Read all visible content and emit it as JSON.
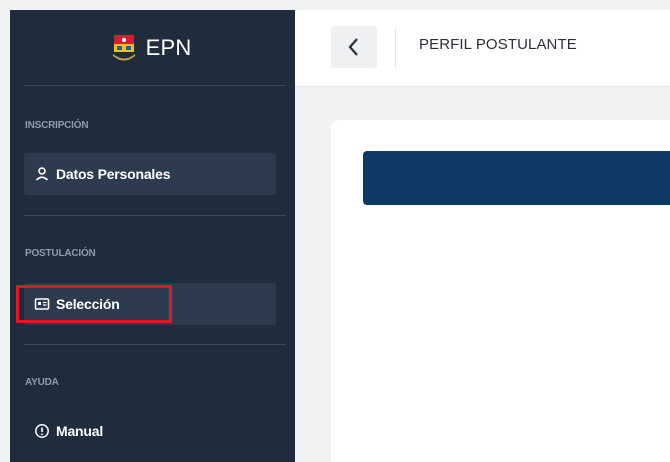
{
  "brand": {
    "name": "EPN"
  },
  "sidebar": {
    "sections": [
      {
        "label": "INSCRIPCIÓN",
        "items": [
          {
            "label": "Datos Personales",
            "icon": "user-icon"
          }
        ]
      },
      {
        "label": "POSTULACIÓN",
        "items": [
          {
            "label": "Selección",
            "icon": "id-card-icon"
          }
        ]
      },
      {
        "label": "AYUDA",
        "items": [
          {
            "label": "Manual",
            "icon": "info-circle-icon"
          }
        ]
      }
    ]
  },
  "header": {
    "title": "PERFIL POSTULANTE",
    "back_icon": "chevron-left-icon"
  },
  "colors": {
    "sidebar_bg": "#1f2c3d",
    "active_item_bg": "#2c3b4e",
    "highlight": "#e11a22",
    "primary_bar": "#0d3b66"
  }
}
